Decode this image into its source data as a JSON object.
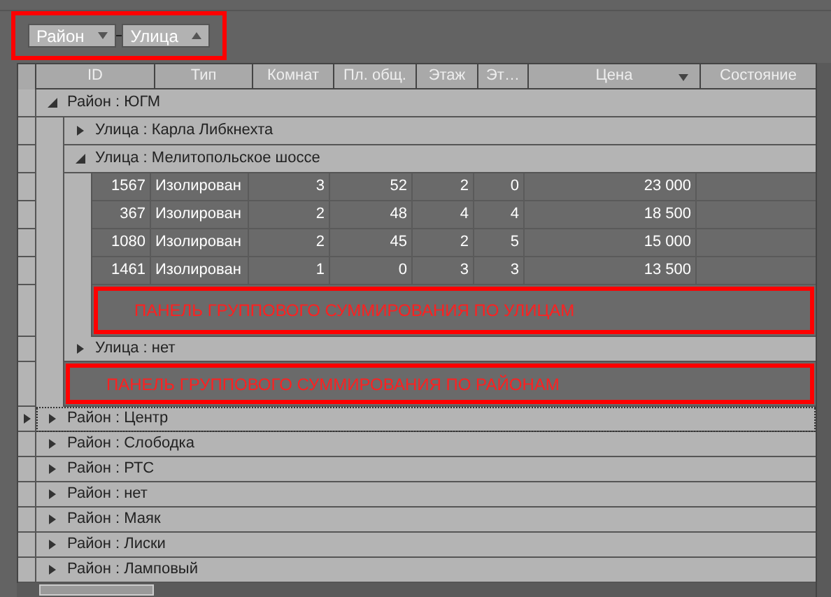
{
  "group_panel": [
    {
      "label": "Район",
      "descending": true
    },
    {
      "label": "Улица",
      "descending": false
    }
  ],
  "columns": [
    {
      "label": "ID"
    },
    {
      "label": "Тип"
    },
    {
      "label": "Комнат"
    },
    {
      "label": "Пл. общ."
    },
    {
      "label": "Этаж"
    },
    {
      "label": "Эт…"
    },
    {
      "label": "Цена",
      "descending": true
    },
    {
      "label": "Состояние"
    }
  ],
  "groups": [
    {
      "label": "Район : ЮГМ",
      "expanded": true,
      "focused": false,
      "children": [
        {
          "label": "Улица : Карла Либкнехта",
          "expanded": false
        },
        {
          "label": "Улица : Мелитопольское шоссе",
          "expanded": true,
          "rows": [
            [
              "1567",
              "Изолирован",
              "3",
              "52",
              "2",
              "0",
              "23 000"
            ],
            [
              "367",
              "Изолирован",
              "2",
              "48",
              "4",
              "4",
              "18 500"
            ],
            [
              "1080",
              "Изолирован",
              "2",
              "45",
              "2",
              "5",
              "15 000"
            ],
            [
              "1461",
              "Изолирован",
              "1",
              "0",
              "3",
              "3",
              "13 500"
            ]
          ],
          "summary": "ПАНЕЛЬ ГРУППОВОГО СУММИРОВАНИЯ ПО УЛИЦАМ"
        },
        {
          "label": "Улица : нет",
          "expanded": false
        }
      ],
      "summary": "ПАНЕЛЬ ГРУППОВОГО СУММИРОВАНИЯ ПО РАЙОНАМ"
    },
    {
      "label": "Район : Центр",
      "expanded": false,
      "focused": true
    },
    {
      "label": "Район : Слободка",
      "expanded": false,
      "focused": false
    },
    {
      "label": "Район : РТС",
      "expanded": false,
      "focused": false
    },
    {
      "label": "Район : нет",
      "expanded": false,
      "focused": false
    },
    {
      "label": "Район : Маяк",
      "expanded": false,
      "focused": false
    },
    {
      "label": "Район : Лиски",
      "expanded": false,
      "focused": false
    },
    {
      "label": "Район : Ламповый",
      "expanded": false,
      "focused": false
    }
  ]
}
